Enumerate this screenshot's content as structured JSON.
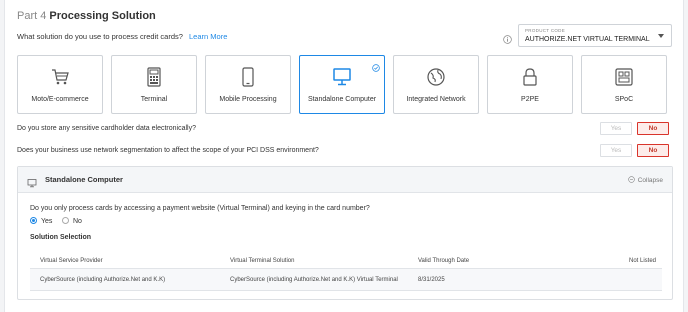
{
  "header": {
    "part_prefix": "Part 4",
    "part_title": "Processing Solution"
  },
  "question": {
    "text": "What solution do you use to process credit cards?",
    "link": "Learn More"
  },
  "product_code": {
    "label": "PRODUCT CODE",
    "value": "AUTHORIZE.NET VIRTUAL TERMINAL"
  },
  "cards": [
    {
      "label": "Moto/E-commerce",
      "icon": "cart-icon"
    },
    {
      "label": "Terminal",
      "icon": "terminal-icon"
    },
    {
      "label": "Mobile Processing",
      "icon": "mobile-icon"
    },
    {
      "label": "Standalone Computer",
      "icon": "monitor-icon",
      "selected": true
    },
    {
      "label": "Integrated Network",
      "icon": "globe-icon"
    },
    {
      "label": "P2PE",
      "icon": "lock-icon"
    },
    {
      "label": "SPoC",
      "icon": "spoc-icon"
    }
  ],
  "questions": [
    {
      "text": "Do you store any sensitive cardholder data electronically?",
      "yes": "Yes",
      "no": "No",
      "selected": "No"
    },
    {
      "text": "Does your business use network segmentation to affect the scope of your PCI DSS environment?",
      "yes": "Yes",
      "no": "No",
      "selected": "No"
    }
  ],
  "panel": {
    "title": "Standalone Computer",
    "collapse": "Collapse",
    "question": "Do you only process cards by accessing a payment website (Virtual Terminal) and keying in the card number?",
    "radio_yes": "Yes",
    "radio_no": "No",
    "radio_selected": "Yes",
    "section_title": "Solution Selection",
    "table": {
      "headers": [
        "Virtual Service Provider",
        "Virtual Terminal Solution",
        "Valid Through Date",
        "Not Listed"
      ],
      "rows": [
        [
          "CyberSource (including Authorize.Net and K.K)",
          "CyberSource (including Authorize.Net and K.K) Virtual Terminal",
          "8/31/2025",
          ""
        ]
      ]
    }
  },
  "colors": {
    "accent": "#1e88e5",
    "no_selected": "#d9342b"
  }
}
